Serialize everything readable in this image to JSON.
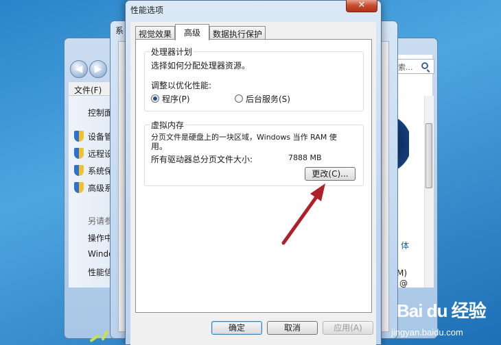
{
  "background_window": {
    "menu_file": "文件(F)",
    "sidebar": [
      {
        "label": "控制面",
        "shield": false
      },
      {
        "label": "设备管",
        "shield": true
      },
      {
        "label": "远程设",
        "shield": true
      },
      {
        "label": "系统保",
        "shield": true
      },
      {
        "label": "高级系",
        "shield": true
      },
      {
        "label": "另请参",
        "shield": false
      },
      {
        "label": "操作中",
        "shield": false
      },
      {
        "label": "Windo",
        "shield": false
      },
      {
        "label": "性能信",
        "shield": false
      }
    ],
    "search_placeholder": "索...",
    "right_texts": [
      "体",
      "M)",
      "@"
    ]
  },
  "middle_window": {
    "title_fragment": "系"
  },
  "dialog": {
    "title": "性能选项",
    "close_label": "✕",
    "tabs": [
      {
        "label": "视觉效果",
        "active": false
      },
      {
        "label": "高级",
        "active": true
      },
      {
        "label": "数据执行保护",
        "active": false
      }
    ],
    "processor_group": {
      "legend": "处理器计划",
      "description": "选择如何分配处理器资源。",
      "optimize_label": "调整以优化性能:",
      "option_programs": "程序(P)",
      "option_services": "后台服务(S)",
      "selected": "programs"
    },
    "virtual_memory_group": {
      "legend": "虚拟内存",
      "description_line1": "分页文件是硬盘上的一块区域，Windows 当作 RAM 使",
      "description_line2": "用。",
      "total_label": "所有驱动器总分页文件大小:",
      "total_value": "7888 MB",
      "change_button": "更改(C)..."
    },
    "buttons": {
      "ok": "确定",
      "cancel": "取消",
      "apply": "应用(A)"
    }
  },
  "watermark": {
    "brand": "Bai du 经验",
    "url": "jingyan.baidu.com"
  },
  "colors": {
    "arrow": "#b0202a",
    "desktop": "#2a84c9"
  }
}
